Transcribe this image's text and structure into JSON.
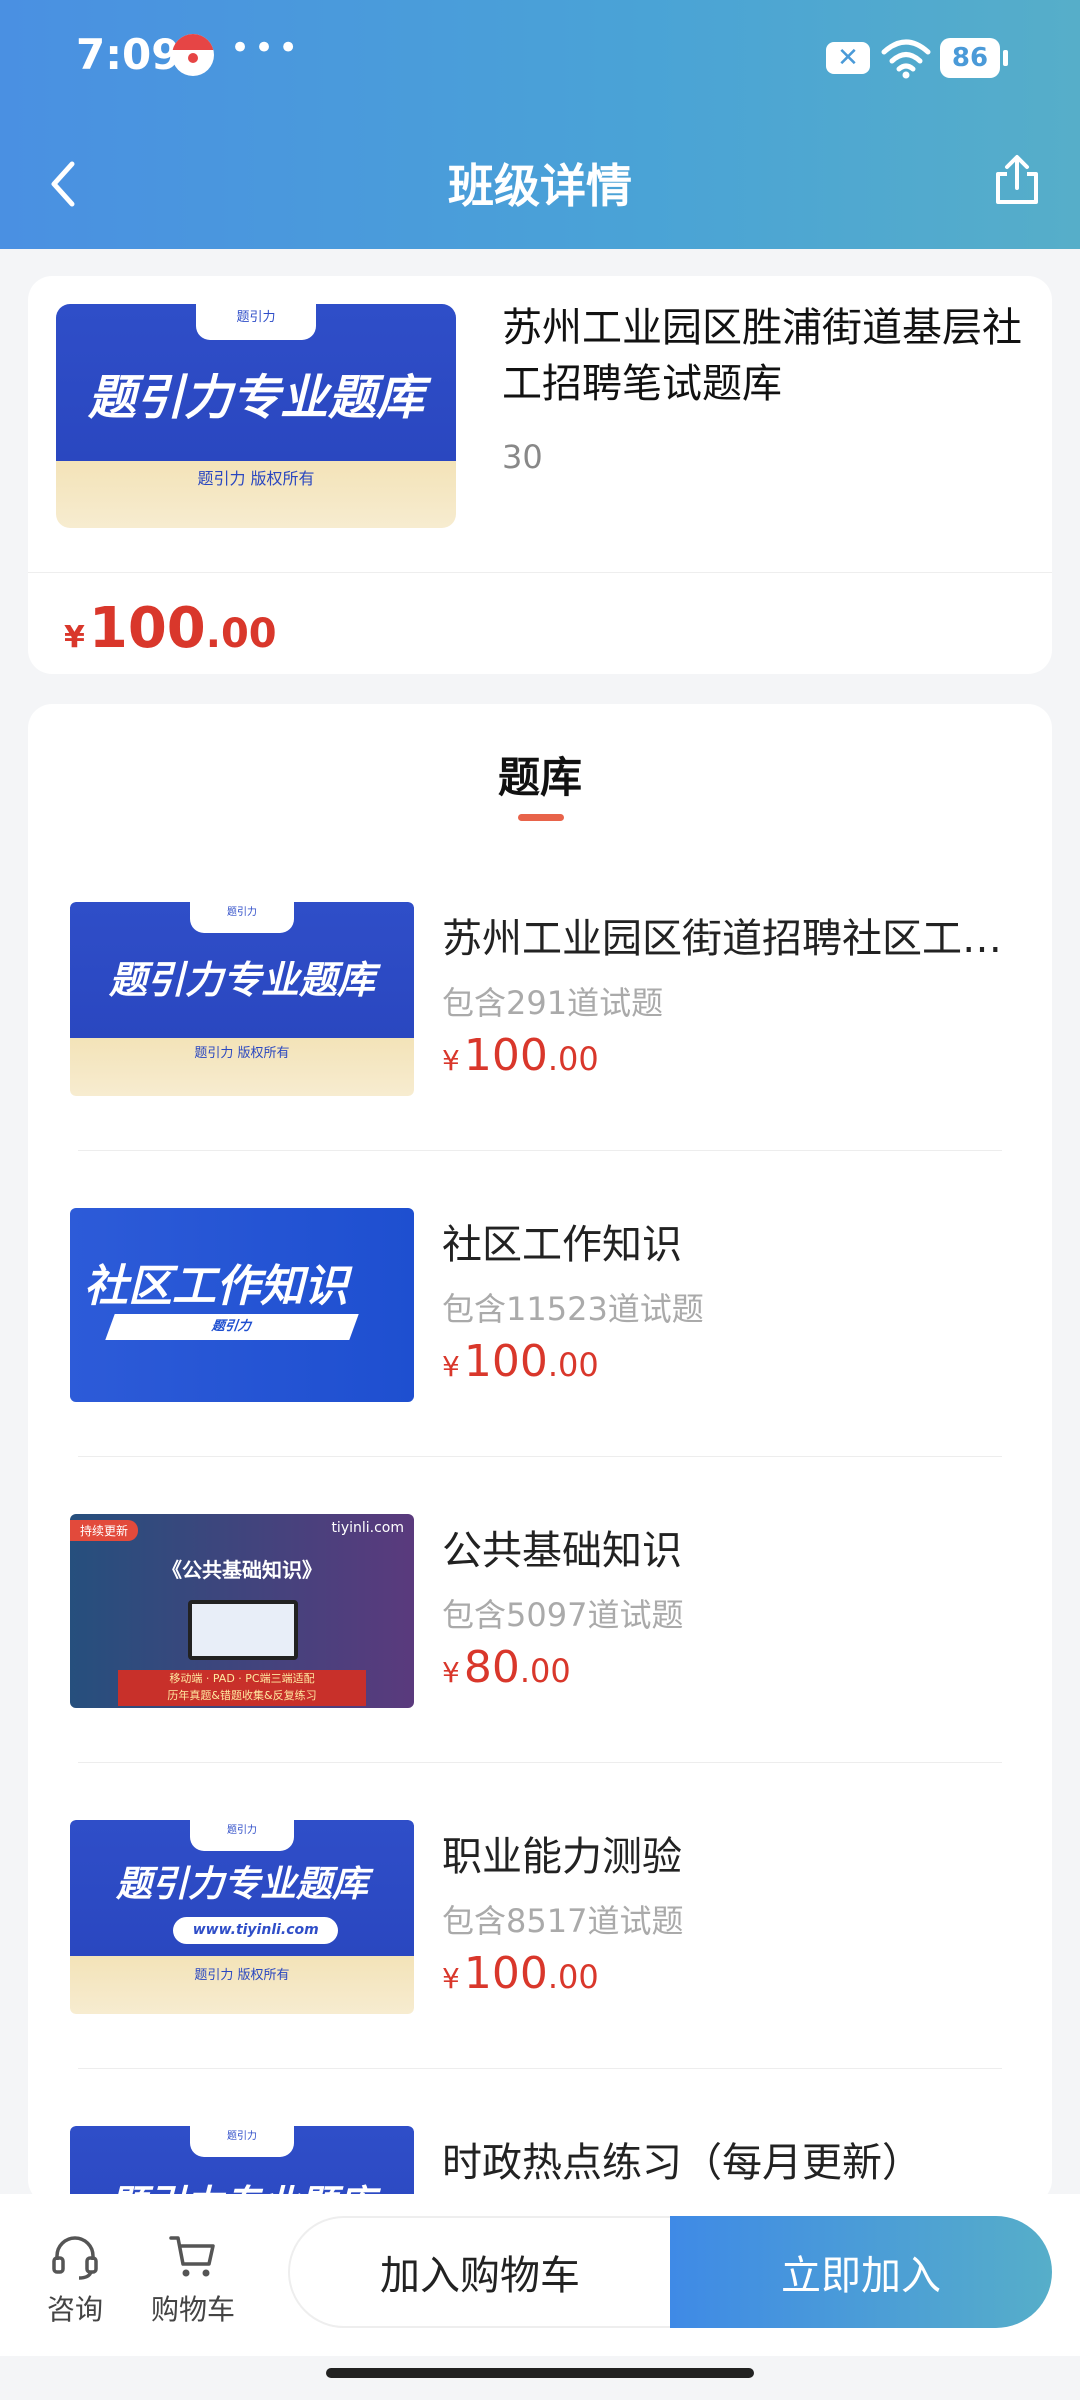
{
  "status_bar": {
    "time": "7:09",
    "dots": "•••",
    "close_glyph": "✕",
    "battery": "86"
  },
  "nav": {
    "title": "班级详情",
    "back_icon": "chevron-left-icon",
    "share_icon": "share-icon"
  },
  "course": {
    "thumb": {
      "tag": "题引力",
      "main": "题引力专业题库",
      "sub": "题引力 版权所有"
    },
    "title": "苏州工业园区胜浦街道基层社工招聘笔试题库",
    "count": "30",
    "price": {
      "yen": "¥",
      "int": "100",
      "dec": ".00"
    }
  },
  "list": {
    "tab_title": "题库",
    "items": [
      {
        "title": "苏州工业园区街道招聘社区工作者题库",
        "count": "包含291道试题",
        "price": {
          "yen": "¥",
          "int": "100",
          "dec": ".00"
        },
        "thumb": {
          "tag": "题引力",
          "main": "题引力专业题库",
          "sub": "题引力 版权所有"
        }
      },
      {
        "title": "社区工作知识",
        "count": "包含11523道试题",
        "price": {
          "yen": "¥",
          "int": "100",
          "dec": ".00"
        },
        "thumb": {
          "main": "社区工作知识",
          "bar": "题引力"
        }
      },
      {
        "title": "公共基础知识",
        "count": "包含5097道试题",
        "price": {
          "yen": "¥",
          "int": "80",
          "dec": ".00"
        },
        "thumb": {
          "badge": "持续更新",
          "brand": "tiyinli.com",
          "main": "《公共基础知识》",
          "foot_line1": "移动端 · PAD · PC端三端适配",
          "foot_line2": "历年真题&错题收集&反复练习"
        }
      },
      {
        "title": "职业能力测验",
        "count": "包含8517道试题",
        "price": {
          "yen": "¥",
          "int": "100",
          "dec": ".00"
        },
        "thumb": {
          "tag": "题引力",
          "main": "题引力专业题库",
          "url": "www.tiyinli.com",
          "sub": "题引力 版权所有"
        }
      },
      {
        "title": "时政热点练习（每月更新）",
        "count": "",
        "price": null,
        "thumb": {
          "tag": "题引力",
          "main": "题引力专业题库",
          "sub": ""
        }
      }
    ]
  },
  "bottom_bar": {
    "consult_label": "咨询",
    "cart_label": "购物车",
    "add_cart_button": "加入购物车",
    "join_button": "立即加入"
  },
  "colors": {
    "accent_blue": "#4a90e2",
    "price_red": "#d9372b",
    "tab_underline": "#e8634a"
  }
}
